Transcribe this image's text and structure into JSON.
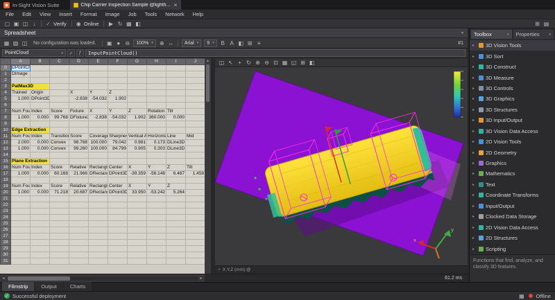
{
  "titlebar": {
    "app_title": "In-Sight Vision Suite",
    "doc_tab": "Chip Carrier Inspection Sample @lighth...",
    "close_glyph": "×"
  },
  "menubar": {
    "items": [
      "File",
      "Edit",
      "View",
      "Insert",
      "Format",
      "Image",
      "Job",
      "Tools",
      "Network",
      "Help"
    ]
  },
  "main_toolbar": {
    "left_icons": [
      {
        "name": "new-job-icon",
        "glyph": "▢"
      },
      {
        "name": "open-job-icon",
        "glyph": "▣"
      },
      {
        "name": "save-job-icon",
        "glyph": "◫"
      },
      {
        "name": "import-job-icon",
        "glyph": "↓"
      }
    ],
    "verify_check_glyph": "✓",
    "verify_label": "Verify",
    "online_icon_glyph": "◉",
    "online_label": "Online",
    "right_icons": [
      {
        "name": "trigger-icon",
        "glyph": "▶"
      },
      {
        "name": "live-acquire-icon",
        "glyph": "↻"
      },
      {
        "name": "filmstrip-toggle-icon",
        "glyph": "▦"
      },
      {
        "name": "layout-toggle-icon",
        "glyph": "◧"
      }
    ],
    "far_icons": [
      {
        "name": "window-layout-icon",
        "glyph": "⊞"
      },
      {
        "name": "help-panel-icon",
        "glyph": "▤"
      }
    ]
  },
  "spreadsheet": {
    "panel_title": "Spreadsheet",
    "collapse_glyph": "▾",
    "toolbar": {
      "view_icons": [
        {
          "name": "grid-view-icon",
          "glyph": "▦"
        },
        {
          "name": "image-view-icon",
          "glyph": "▧"
        },
        {
          "name": "overlay-view-icon",
          "glyph": "◫"
        }
      ],
      "status_message": "No configuration was loaded.",
      "mid_icons": [
        {
          "name": "snapshot-icon",
          "glyph": "▣"
        },
        {
          "name": "record-icon",
          "glyph": "●"
        },
        {
          "name": "zoom-out-icon",
          "glyph": "⊖"
        }
      ],
      "zoom_value": "100%",
      "zoom_icons": [
        {
          "name": "zoom-in-icon",
          "glyph": "⊕"
        },
        {
          "name": "fit-window-icon",
          "glyph": "↔"
        }
      ],
      "font_name": "Arial",
      "font_size": "9",
      "format_icons": [
        {
          "name": "bold-icon",
          "glyph": "B"
        },
        {
          "name": "text-color-icon",
          "glyph": "A"
        },
        {
          "name": "fill-color-icon",
          "glyph": "◧"
        },
        {
          "name": "borders-icon",
          "glyph": "⊞"
        },
        {
          "name": "align-left-icon",
          "glyph": "≡"
        }
      ],
      "sheet_badge": "#1"
    },
    "name_box": "PointCloud",
    "fx_label": "ƒ",
    "check_label": "✓",
    "formula": "InputPointCloud()",
    "columns": [
      "A",
      "B",
      "C",
      "D",
      "E",
      "F",
      "G",
      "H",
      "I",
      "J"
    ],
    "rows": [
      {
        "n": 0,
        "sel": true,
        "cells": [
          "DPointCloud"
        ]
      },
      {
        "n": 1,
        "cells": [
          "DImage"
        ]
      },
      {
        "n": 2,
        "cells": []
      },
      {
        "n": 3,
        "section": true,
        "cells": [
          "PatMax3D"
        ]
      },
      {
        "n": 4,
        "cells": [
          "Trained",
          "Origin",
          "",
          "X",
          "Y",
          "Z"
        ]
      },
      {
        "n": 5,
        "cells": [
          "1.000",
          "DPoint3D",
          "",
          "-2.838",
          "-54.032",
          "1.902"
        ]
      },
      {
        "n": 6,
        "cells": []
      },
      {
        "n": 7,
        "cells": [
          "Num Found",
          "Index",
          "Score",
          "Fixture",
          "X",
          "Y",
          "Z",
          "Rotation",
          "Tilt"
        ]
      },
      {
        "n": 8,
        "cells": [
          "1.000",
          "0.000",
          "99.768",
          "DFixture3D",
          "-2.838",
          "-54.032",
          "1.902",
          "360.000",
          "0.000"
        ]
      },
      {
        "n": 9,
        "cells": []
      },
      {
        "n": 10,
        "section": true,
        "cells": [
          "Edge Extraction"
        ]
      },
      {
        "n": 11,
        "cells": [
          "Num Found",
          "Index",
          "Transition",
          "Score",
          "Coverage",
          "Sharpness",
          "Vertical An",
          "Horizontal",
          "Line",
          "Mid"
        ]
      },
      {
        "n": 12,
        "cells": [
          "2.000",
          "0.000",
          "Convex",
          "98.768",
          "100.000",
          "79.042",
          "0.981",
          "0.173",
          "DLine3D"
        ]
      },
      {
        "n": 13,
        "cells": [
          "1.000",
          "0.000",
          "Convex",
          "99.260",
          "100.000",
          "84.799",
          "0.905",
          "0.303",
          "DLine3D"
        ]
      },
      {
        "n": 14,
        "cells": []
      },
      {
        "n": 15,
        "section": true,
        "cells": [
          "Plane Extraction"
        ]
      },
      {
        "n": 16,
        "cells": [
          "Num Found",
          "Index",
          "Score",
          "Relative Til",
          "Rectangle",
          "Center",
          "X",
          "Y",
          "Z",
          "Tilt"
        ]
      },
      {
        "n": 17,
        "cells": [
          "1.000",
          "0.000",
          "60.168",
          "21.966",
          "DRectangl",
          "DPoint3D",
          "-39.359",
          "-56.148",
          "6.487",
          "1.458"
        ]
      },
      {
        "n": 18,
        "cells": []
      },
      {
        "n": 19,
        "cells": [
          "Num Found",
          "Index",
          "Score",
          "Relative Til",
          "Rectangle",
          "Center",
          "X",
          "Y",
          "Z"
        ]
      },
      {
        "n": 20,
        "cells": [
          "1.000",
          "0.000",
          "71.218",
          "20.687",
          "DRectangl",
          "DPoint3D",
          "33.950",
          "-53.242",
          "5.264"
        ]
      },
      {
        "n": 21,
        "cells": []
      },
      {
        "n": 22,
        "cells": []
      },
      {
        "n": 23,
        "cells": []
      },
      {
        "n": 24,
        "cells": []
      },
      {
        "n": 25,
        "cells": []
      },
      {
        "n": 26,
        "cells": []
      },
      {
        "n": 27,
        "cells": []
      },
      {
        "n": 28,
        "cells": []
      },
      {
        "n": 29,
        "cells": []
      },
      {
        "n": 30,
        "cells": []
      },
      {
        "n": 31,
        "cells": []
      }
    ]
  },
  "viewport": {
    "toolbar_icons": [
      {
        "name": "export-view-icon",
        "glyph": "◫"
      },
      {
        "name": "select-pointer-icon",
        "glyph": "↖"
      },
      {
        "name": "pan-icon",
        "glyph": "+"
      },
      {
        "name": "rotate-3d-icon",
        "glyph": "↻"
      },
      {
        "name": "zoom-in-3d-icon",
        "glyph": "⊕"
      },
      {
        "name": "zoom-out-3d-icon",
        "glyph": "⊖"
      },
      {
        "name": "zoom-fit-icon",
        "glyph": "⊡"
      },
      {
        "name": "view-top-icon",
        "glyph": "▦"
      },
      {
        "name": "view-iso-icon",
        "glyph": "◱"
      },
      {
        "name": "show-grid-icon",
        "glyph": "⊞"
      },
      {
        "name": "render-settings-icon",
        "glyph": "◧"
      }
    ],
    "coords_label": "X,Y,Z (mm) @",
    "render_time": "61.2 ms",
    "colorbar_colors": [
      "#f2ea3a",
      "#6fd23c",
      "#2fc8b4",
      "#2f72d2",
      "#1f2ba0"
    ],
    "plane_color": "#8b12d2",
    "object_color": "#ffd71c"
  },
  "toolbox": {
    "tab_toolbox": "Toolbox",
    "tab_properties": "Properties",
    "items": [
      {
        "label": "3D Vision Tools",
        "color": "#e8962e"
      },
      {
        "label": "3D Sort",
        "color": "#4a90d9"
      },
      {
        "label": "3D Construct",
        "color": "#2fb3a3"
      },
      {
        "label": "3D Measure",
        "color": "#4a90d9"
      },
      {
        "label": "3D Controls",
        "color": "#7a8fa6"
      },
      {
        "label": "3D Graphics",
        "color": "#5aa0e0"
      },
      {
        "label": "3D Structures",
        "color": "#8899aa"
      },
      {
        "label": "3D Input/Output",
        "color": "#e8962e"
      },
      {
        "label": "3D Vision Data Access",
        "color": "#2fb3a3"
      },
      {
        "label": "2D Vision Tools",
        "color": "#4a90d9"
      },
      {
        "label": "2D Geometry",
        "color": "#e8a33d"
      },
      {
        "label": "Graphics",
        "color": "#9b6bd4"
      },
      {
        "label": "Mathematics",
        "color": "#6aae4f"
      },
      {
        "label": "Text",
        "color": "#2f8f8f"
      },
      {
        "label": "Coordinate Transforms",
        "color": "#2fb3a3"
      },
      {
        "label": "Input/Output",
        "color": "#4a90d9"
      },
      {
        "label": "Clocked Data Storage",
        "color": "#9aa0a6"
      },
      {
        "label": "2D Vision Data Access",
        "color": "#2fb3a3"
      },
      {
        "label": "2D Structures",
        "color": "#5aa0e0"
      },
      {
        "label": "Scripting",
        "color": "#6aae4f"
      }
    ],
    "description": "Functions that find, analyze, and classify 3D features."
  },
  "bottom_tabs": {
    "tabs": [
      {
        "label": "Filmstrip",
        "active": true
      },
      {
        "label": "Output",
        "active": false
      },
      {
        "label": "Charts",
        "active": false
      }
    ]
  },
  "statusbar": {
    "ok_glyph": "✓",
    "message": "Successful deployment",
    "connection_label": "Offline"
  }
}
